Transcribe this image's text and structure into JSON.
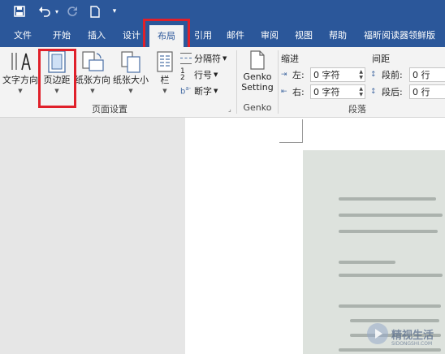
{
  "qat": {
    "save_icon": "save-icon",
    "undo_icon": "undo-icon",
    "redo_icon": "redo-icon",
    "new_icon": "new-document-icon",
    "customize": "▾"
  },
  "tabs": [
    "文件",
    "开始",
    "插入",
    "设计",
    "布局",
    "引用",
    "邮件",
    "审阅",
    "视图",
    "帮助",
    "福昕阅读器领鲜版"
  ],
  "active_tab": "布局",
  "page_setup": {
    "text_direction": "文字方向",
    "margins": "页边距",
    "orientation": "纸张方向",
    "size": "纸张大小",
    "columns": "栏",
    "breaks": "分隔符",
    "line_numbers": "行号",
    "hyphenation": "断字",
    "group_label": "页面设置"
  },
  "genko": {
    "button_line1": "Genko",
    "button_line2": "Setting",
    "group_label": "Genko"
  },
  "paragraph": {
    "indent_header": "缩进",
    "spacing_header": "间距",
    "left_label": "左:",
    "left_value": "0 字符",
    "right_label": "右:",
    "right_value": "0 字符",
    "before_label": "段前:",
    "before_value": "0 行",
    "after_label": "段后:",
    "after_value": "0 行",
    "group_label": "段落"
  },
  "watermark": {
    "text": "精视生活",
    "sub": "SIDONGSHI.COM"
  },
  "colors": {
    "ribbon_blue": "#2b579a",
    "highlight_red": "#e0202a"
  }
}
